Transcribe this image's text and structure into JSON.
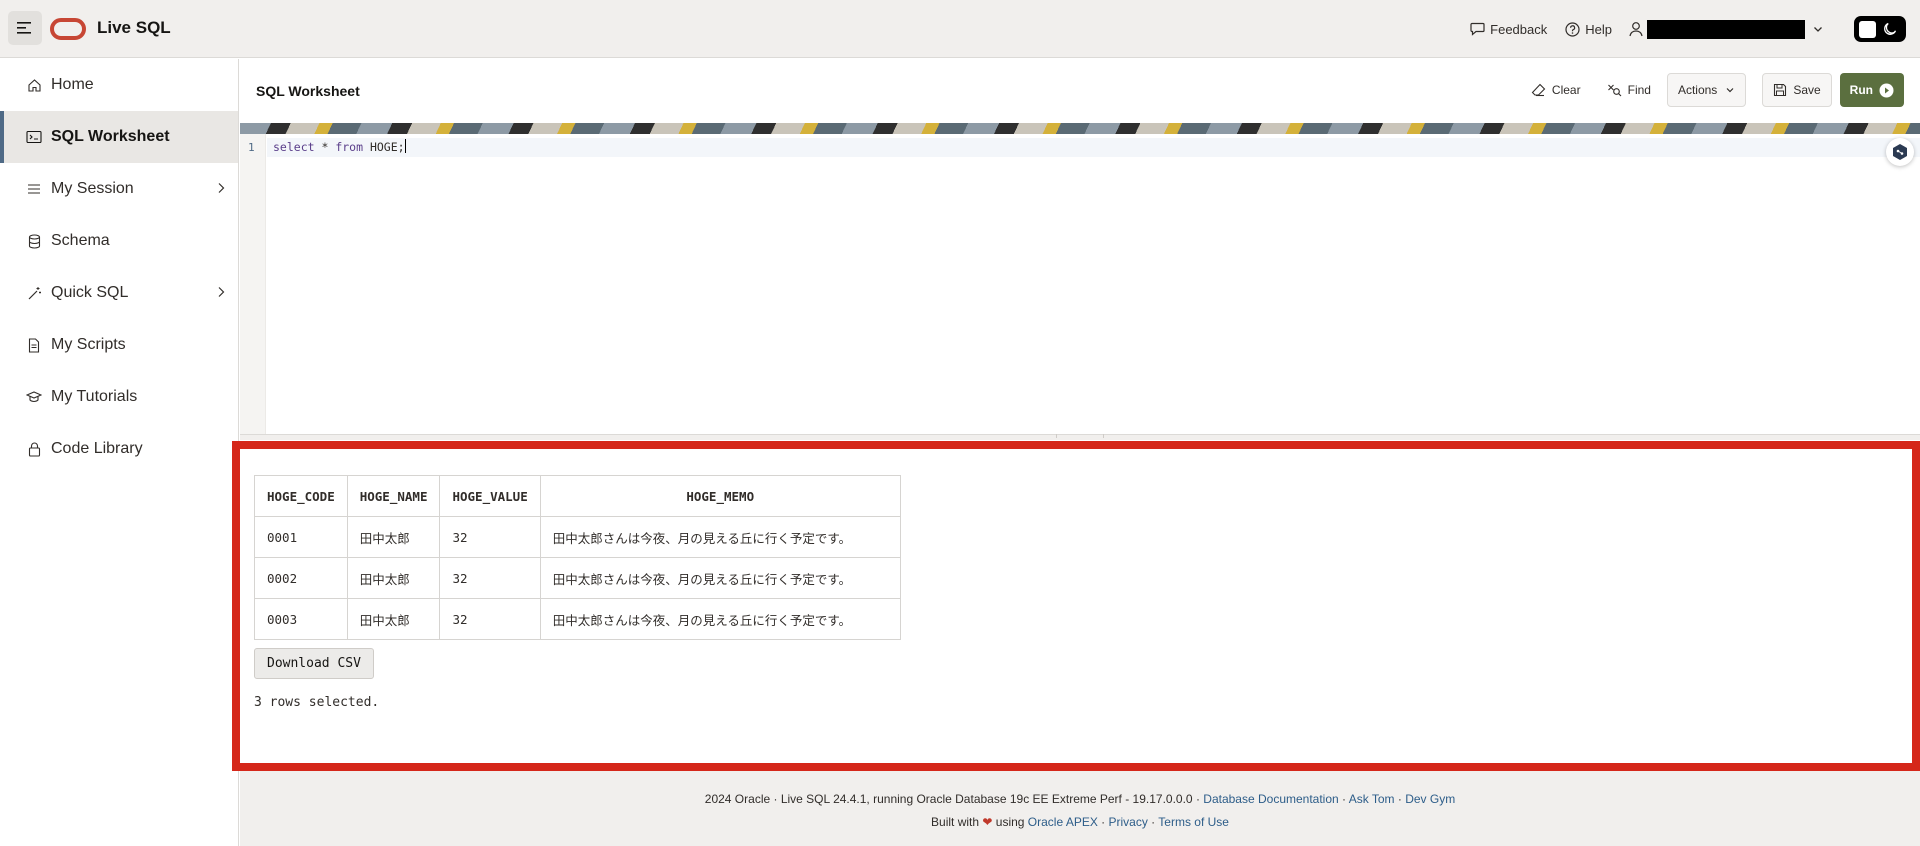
{
  "header": {
    "app_title": "Live SQL",
    "feedback_label": "Feedback",
    "help_label": "Help"
  },
  "sidebar": {
    "items": [
      {
        "label": "Home",
        "icon": "home-icon"
      },
      {
        "label": "SQL Worksheet",
        "icon": "terminal-icon"
      },
      {
        "label": "My Session",
        "icon": "list-icon"
      },
      {
        "label": "Schema",
        "icon": "database-icon"
      },
      {
        "label": "Quick SQL",
        "icon": "wand-icon"
      },
      {
        "label": "My Scripts",
        "icon": "file-icon"
      },
      {
        "label": "My Tutorials",
        "icon": "graduation-cap-icon"
      },
      {
        "label": "Code Library",
        "icon": "library-icon"
      }
    ]
  },
  "worksheet": {
    "title": "SQL Worksheet",
    "clear_label": "Clear",
    "find_label": "Find",
    "actions_label": "Actions",
    "save_label": "Save",
    "run_label": "Run"
  },
  "editor": {
    "line_number": "1",
    "code_kw1": "select",
    "code_star": " * ",
    "code_kw2": "from",
    "code_rest": " HOGE;"
  },
  "results": {
    "columns": [
      "HOGE_CODE",
      "HOGE_NAME",
      "HOGE_VALUE",
      "HOGE_MEMO"
    ],
    "rows": [
      [
        "0001",
        "田中太郎",
        "32",
        "田中太郎さんは今夜、月の見える丘に行く予定です。"
      ],
      [
        "0002",
        "田中太郎",
        "32",
        "田中太郎さんは今夜、月の見える丘に行く予定です。"
      ],
      [
        "0003",
        "田中太郎",
        "32",
        "田中太郎さんは今夜、月の見える丘に行く予定です。"
      ]
    ],
    "download_label": "Download CSV",
    "rows_message": "3 rows selected."
  },
  "footer": {
    "line1_text": "2024 Oracle · Live SQL 24.4.1, running Oracle Database 19c EE Extreme Perf - 19.17.0.0.0 · ",
    "link_docs": "Database Documentation",
    "sep1": " · ",
    "link_asktom": "Ask Tom",
    "sep2": " · ",
    "link_devgym": "Dev Gym",
    "built_with": "Built with ",
    "heart": "❤",
    "using": " using ",
    "link_apex": "Oracle APEX",
    "sep3": " · ",
    "link_privacy": "Privacy",
    "sep4": " · ",
    "link_terms": "Terms of Use"
  },
  "colors": {
    "accent_run": "#5b6f3f",
    "highlight_border": "#d5271a",
    "oracle_red": "#c74634",
    "link": "#2d5d89"
  }
}
